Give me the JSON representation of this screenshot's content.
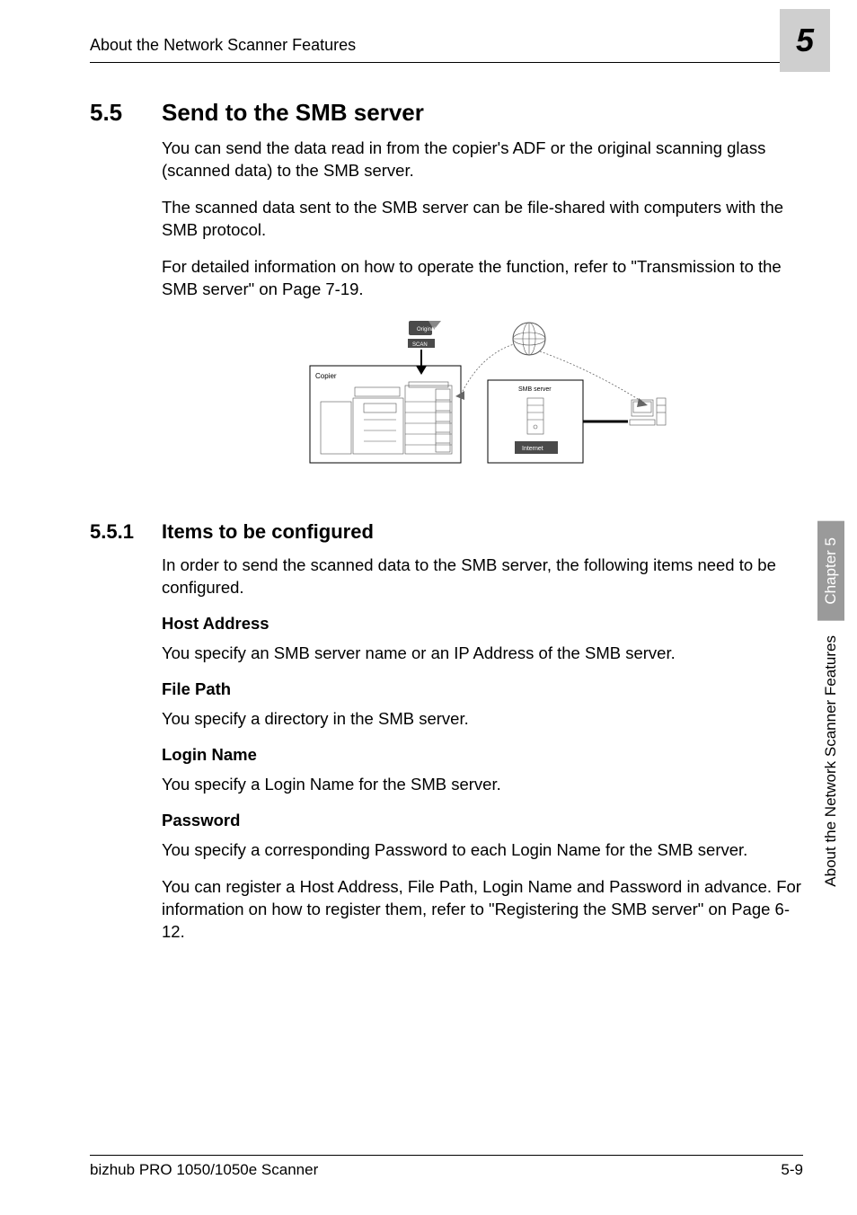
{
  "header": {
    "running_head": "About the Network Scanner Features",
    "chapter_number": "5"
  },
  "section55": {
    "number": "5.5",
    "title": "Send to the SMB server",
    "p1": "You can send the data read in from the copier's ADF or the original scanning glass (scanned data) to the SMB server.",
    "p2": "The scanned data sent to the SMB server can be file-shared with computers with the SMB protocol.",
    "p3": "For detailed information on how to operate the function, refer to \"Transmission to the SMB server\" on Page 7-19."
  },
  "diagram": {
    "original": "Original",
    "scan": "SCAN",
    "copier": "Copier",
    "smb_server": "SMB server",
    "internet": "Internet"
  },
  "section551": {
    "number": "5.5.1",
    "title": "Items to be configured",
    "intro": "In order to send the scanned data to the SMB server, the following items need to be configured.",
    "host_address_h": "Host Address",
    "host_address_p": "You specify an SMB server name or an IP Address of the SMB server.",
    "file_path_h": "File Path",
    "file_path_p": "You specify a directory in the SMB server.",
    "login_name_h": "Login Name",
    "login_name_p": "You specify a Login Name for the SMB server.",
    "password_h": "Password",
    "password_p1": "You specify a corresponding Password to each Login Name for the SMB server.",
    "password_p2": "You can register a Host Address, File Path, Login Name and Password in advance. For information on how to register them, refer to \"Registering the SMB server\" on Page 6-12."
  },
  "sidebar": {
    "tab": "Chapter 5",
    "label": "About the Network Scanner Features"
  },
  "footer": {
    "left": "bizhub PRO 1050/1050e Scanner",
    "right": "5-9"
  }
}
